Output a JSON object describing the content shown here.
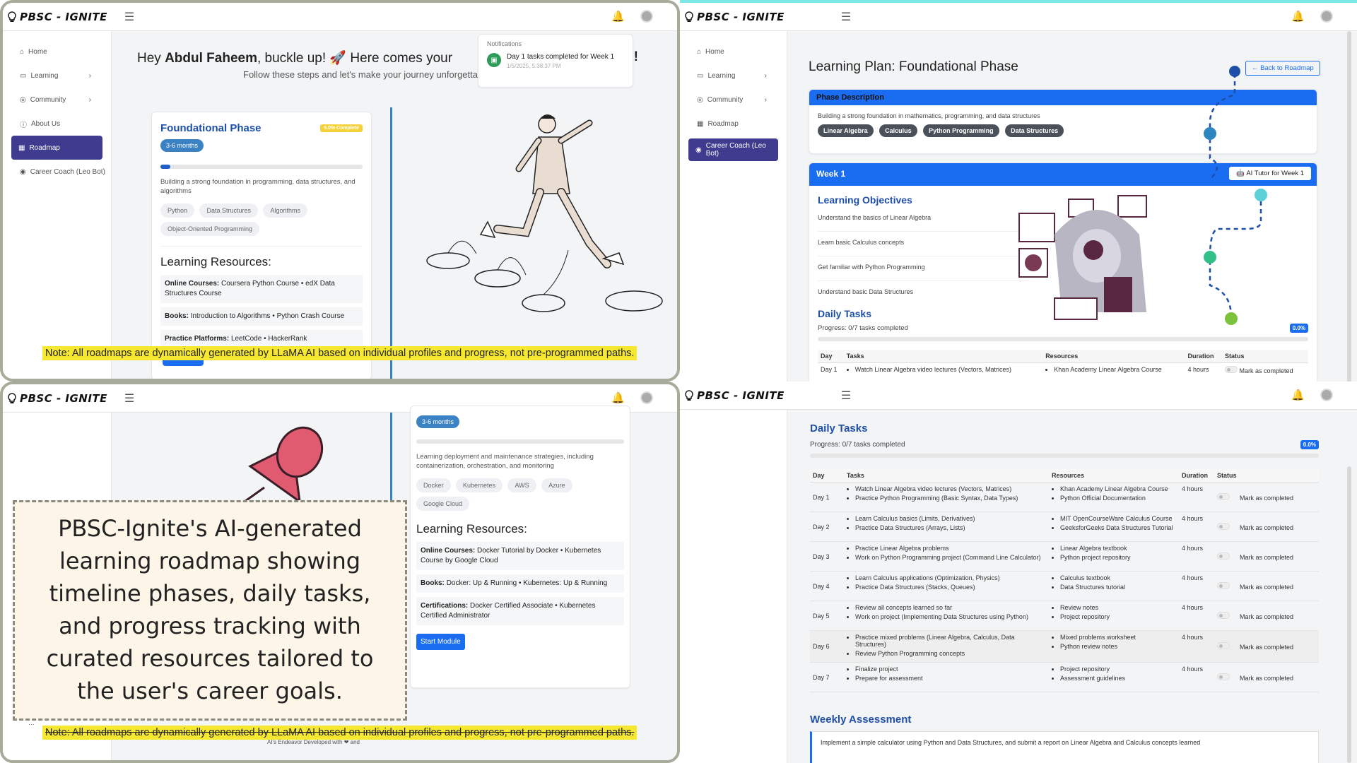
{
  "brand": {
    "name": "PBSC - IGNITE"
  },
  "sidebar": {
    "items": [
      {
        "label": "Home",
        "icon": "home-icon"
      },
      {
        "label": "Learning",
        "icon": "book-icon",
        "chevron": true
      },
      {
        "label": "Community",
        "icon": "users-icon",
        "chevron": true
      },
      {
        "label": "About Us",
        "icon": "info-icon"
      },
      {
        "label": "Roadmap",
        "icon": "map-icon"
      },
      {
        "label": "Career Coach (Leo Bot)",
        "icon": "robot-icon"
      }
    ]
  },
  "q1": {
    "greeting_pre": "Hey ",
    "greeting_name": "Abdul Faheem",
    "greeting_post": ", buckle up! 🚀 Here comes your",
    "greeting_end": "s!",
    "subtitle": "Follow these steps and let's make your journey unforgettable. R",
    "notifications": {
      "title": "Notifications",
      "item_text": "Day 1 tasks completed for Week 1",
      "item_time": "1/5/2025, 5:38:37 PM"
    },
    "phase": {
      "title": "Foundational Phase",
      "badge": "5.0% Complete",
      "duration": "3-6 months",
      "progress": 0.05,
      "description": "Building a strong foundation in programming, data structures, and algorithms",
      "chips": [
        "Python",
        "Data Structures",
        "Algorithms",
        "Object-Oriented Programming"
      ],
      "resources_title": "Learning Resources:",
      "resources": [
        {
          "label": "Online Courses:",
          "text": "Coursera Python Course • edX Data Structures Course"
        },
        {
          "label": "Books:",
          "text": "Introduction to Algorithms • Python Crash Course"
        },
        {
          "label": "Practice Platforms:",
          "text": "LeetCode • HackerRank"
        }
      ]
    },
    "note": "Note: All roadmaps are dynamically generated by LLaMA AI based on individual profiles and progress, not pre-programmed paths."
  },
  "q2": {
    "title": "Learning Plan: Foundational Phase",
    "back_button": "Back to Roadmap",
    "phase_desc_header": "Phase Description",
    "phase_desc": "Building a strong foundation in mathematics, programming, and data structures",
    "tags": [
      "Linear Algebra",
      "Calculus",
      "Python Programming",
      "Data Structures"
    ],
    "week_header": "Week 1",
    "ai_tutor_button": "AI Tutor for Week 1",
    "objectives_title": "Learning Objectives",
    "objectives": [
      "Understand the basics of Linear Algebra",
      "Learn basic Calculus concepts",
      "Get familiar with Python Programming",
      "Understand basic Data Structures"
    ],
    "daily_title": "Daily Tasks",
    "progress_text": "Progress: 0/7 tasks completed",
    "progress_badge": "0.0%",
    "table_headers": [
      "Day",
      "Tasks",
      "Resources",
      "Duration",
      "Status"
    ],
    "first_row": {
      "day": "Day 1",
      "task": "Watch Linear Algebra video lectures (Vectors, Matrices)",
      "resource": "Khan Academy Linear Algebra Course",
      "duration": "4 hours",
      "status": "Mark as completed"
    }
  },
  "q3": {
    "duration": "3-6 months",
    "description": "Learning deployment and maintenance strategies, including containerization, orchestration, and monitoring",
    "chips": [
      "Docker",
      "Kubernetes",
      "AWS",
      "Azure",
      "Google Cloud"
    ],
    "resources_title": "Learning Resources:",
    "resources": [
      {
        "label": "Online Courses:",
        "text": "Docker Tutorial by Docker • Kubernetes Course by Google Cloud"
      },
      {
        "label": "Books:",
        "text": "Docker: Up & Running • Kubernetes: Up & Running"
      },
      {
        "label": "Certifications:",
        "text": "Docker Certified Associate • Kubernetes Certified Administrator"
      }
    ],
    "start_button": "Start Module",
    "caption": "PBSC-Ignite's AI-generated learning roadmap showing timeline phases, daily tasks, and progress tracking with curated resources tailored to the user's career goals.",
    "note": "Note: All roadmaps are dynamically generated by LLaMA AI based on individual profiles and progress, not pre-programmed paths.",
    "footer_partial": "AI's Endeavor Developed with",
    "footer_and": "and"
  },
  "q4": {
    "daily_title": "Daily Tasks",
    "progress_text": "Progress: 0/7 tasks completed",
    "progress_badge": "0.0%",
    "table_headers": [
      "Day",
      "Tasks",
      "Resources",
      "Duration",
      "Status"
    ],
    "rows": [
      {
        "day": "Day 1",
        "tasks": [
          "Watch Linear Algebra video lectures (Vectors, Matrices)",
          "Practice Python Programming (Basic Syntax, Data Types)"
        ],
        "resources": [
          "Khan Academy Linear Algebra Course",
          "Python Official Documentation"
        ],
        "duration": "4 hours",
        "status": "Mark as completed"
      },
      {
        "day": "Day 2",
        "tasks": [
          "Learn Calculus basics (Limits, Derivatives)",
          "Practice Data Structures (Arrays, Lists)"
        ],
        "resources": [
          "MIT OpenCourseWare Calculus Course",
          "GeeksforGeeks Data Structures Tutorial"
        ],
        "duration": "4 hours",
        "status": "Mark as completed"
      },
      {
        "day": "Day 3",
        "tasks": [
          "Practice Linear Algebra problems",
          "Work on Python Programming project (Command Line Calculator)"
        ],
        "resources": [
          "Linear Algebra textbook",
          "Python project repository"
        ],
        "duration": "4 hours",
        "status": "Mark as completed"
      },
      {
        "day": "Day 4",
        "tasks": [
          "Learn Calculus applications (Optimization, Physics)",
          "Practice Data Structures (Stacks, Queues)"
        ],
        "resources": [
          "Calculus textbook",
          "Data Structures tutorial"
        ],
        "duration": "4 hours",
        "status": "Mark as completed"
      },
      {
        "day": "Day 5",
        "tasks": [
          "Review all concepts learned so far",
          "Work on project (Implementing Data Structures using Python)"
        ],
        "resources": [
          "Review notes",
          "Project repository"
        ],
        "duration": "4 hours",
        "status": "Mark as completed"
      },
      {
        "day": "Day 6",
        "tasks": [
          "Practice mixed problems (Linear Algebra, Calculus, Data Structures)",
          "Review Python Programming concepts"
        ],
        "resources": [
          "Mixed problems worksheet",
          "Python review notes"
        ],
        "duration": "4 hours",
        "status": "Mark as completed"
      },
      {
        "day": "Day 7",
        "tasks": [
          "Finalize project",
          "Prepare for assessment"
        ],
        "resources": [
          "Project repository",
          "Assessment guidelines"
        ],
        "duration": "4 hours",
        "status": "Mark as completed"
      }
    ],
    "assessment_title": "Weekly Assessment",
    "assessment_text": "Implement a simple calculator using Python and Data Structures, and submit a report on Linear Algebra and Calculus concepts learned"
  },
  "colors": {
    "accent": "#3f3b8e",
    "blue": "#1a6df0",
    "highlight": "#f6e830"
  }
}
